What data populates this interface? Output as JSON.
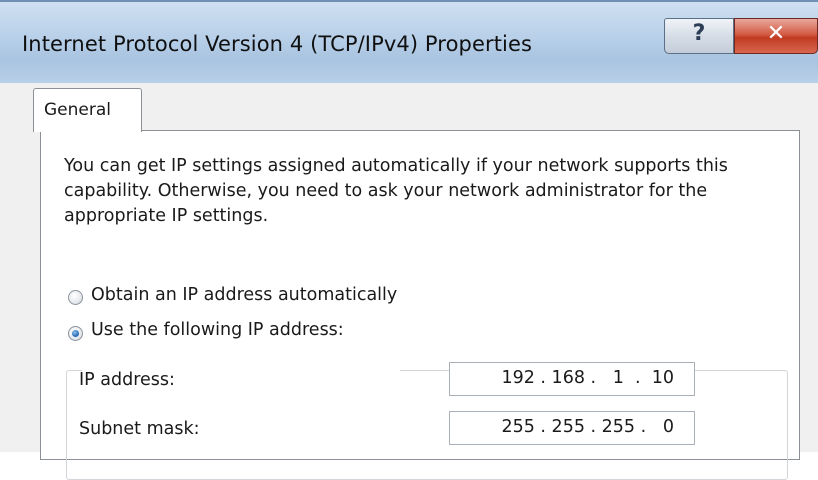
{
  "window": {
    "title": "Internet Protocol Version 4 (TCP/IPv4) Properties",
    "help_glyph": "?",
    "close_glyph": "✕"
  },
  "tabs": [
    {
      "label": "General",
      "selected": true
    }
  ],
  "general": {
    "description": "You can get IP settings assigned automatically if your network supports this capability. Otherwise, you need to ask your network administrator for the appropriate IP settings.",
    "ip_mode": {
      "options": [
        {
          "label": "Obtain an IP address automatically",
          "checked": false
        },
        {
          "label": "Use the following IP address:",
          "checked": true
        }
      ]
    },
    "fields": [
      {
        "label": "IP address:",
        "value": "192 . 168 .   1  .  10"
      },
      {
        "label": "Subnet mask:",
        "value": "255 . 255 . 255 .   0"
      }
    ]
  },
  "colors": {
    "titlebar": "#bcd3ea",
    "close_button": "#c13b22",
    "dialog_bg": "#f0f0f0",
    "radio_selected": "#2b6fb6"
  }
}
